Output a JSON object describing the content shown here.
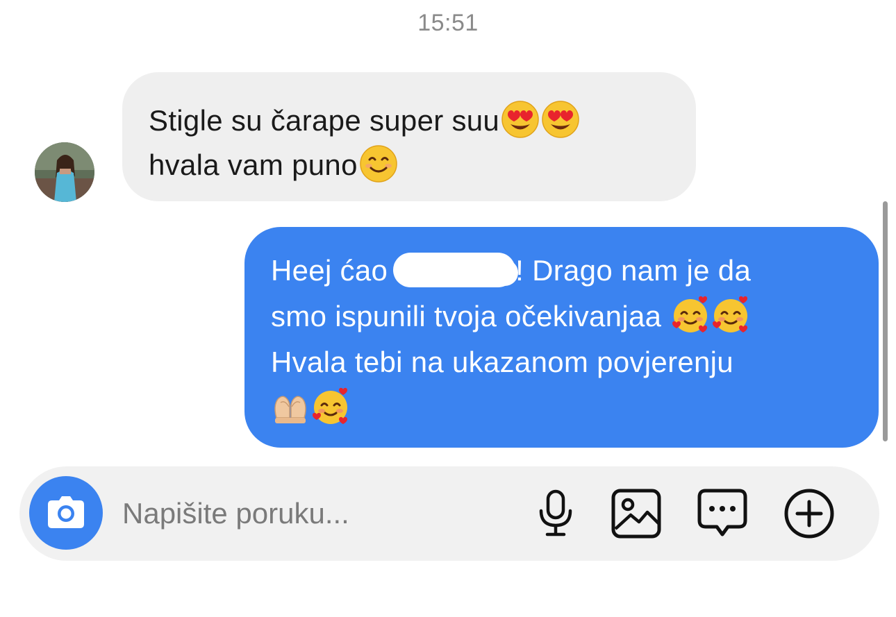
{
  "chat": {
    "timestamp": "15:51",
    "incoming": {
      "line1": "Stigle su čarape super suu",
      "line2": "hvala vam puno",
      "line1_emojis": [
        "heart-eyes-emoji",
        "heart-eyes-emoji"
      ],
      "line2_emojis": [
        "smiling-emoji"
      ]
    },
    "outgoing": {
      "line1_start": "Heej ćao",
      "line1_end": "! Drago nam je da",
      "line2": "smo ispunili tvoja očekivanjaa",
      "line3": "Hvala tebi na ukazanom povjerenju",
      "line2_emojis": [
        "smiling-face-with-hearts-emoji",
        "smiling-face-with-hearts-emoji"
      ],
      "line4_emojis": [
        "heart-hands-emoji",
        "smiling-face-with-hearts-emoji"
      ]
    }
  },
  "composer": {
    "placeholder": "Napišite poruku..."
  },
  "icons": {
    "camera": "camera-icon",
    "microphone": "microphone-icon",
    "gallery": "gallery-icon",
    "sticker": "chat-bubble-icon",
    "add": "plus-circle-icon"
  },
  "colors": {
    "outgoing_bubble": "#3b83f0",
    "incoming_bubble": "#efefef",
    "accent": "#3b83f0"
  }
}
